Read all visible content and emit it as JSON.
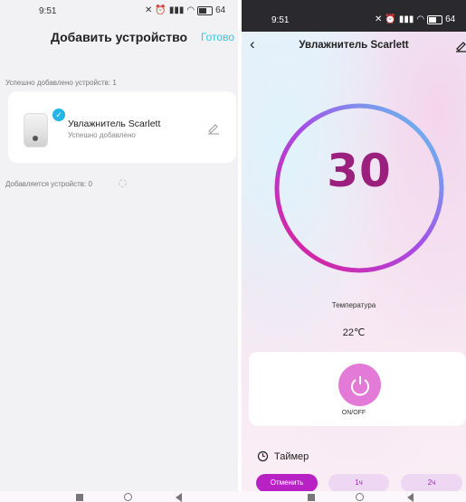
{
  "left": {
    "status": {
      "time": "9:51",
      "battery": "64"
    },
    "title": "Добавить устройство",
    "done_label": "Готово",
    "added_summary": "Успешно добавлено устройств: 1",
    "device": {
      "name": "Увлажнитель Scarlett",
      "status": "Успешно добавлено"
    },
    "adding_summary": "Добавляется устройств: 0"
  },
  "right": {
    "status": {
      "time": "9:51",
      "battery": "64"
    },
    "title": "Увлажнитель Scarlett",
    "target_value": "30",
    "temperature_label": "Температура",
    "temperature_value": "22℃",
    "power_label": "ON/OFF",
    "timer_label": "Таймер",
    "timer_options": [
      "Отменить",
      "1ч",
      "2ч"
    ]
  },
  "colors": {
    "accent_cyan": "#34c5e6",
    "ring_start": "#e11a8e",
    "ring_mid": "#a74be8",
    "ring_end": "#5ad0f0",
    "value_color": "#9b1f7c",
    "power_button": "#e37ad8",
    "chip_active": "#b822c4",
    "chip_inactive": "#eed7f3"
  },
  "icons": [
    "check-icon",
    "pencil-icon",
    "back-arrow-icon",
    "edit-icon",
    "power-icon",
    "timer-icon",
    "spinner-icon",
    "battery-icon",
    "wifi-icon",
    "signal-icon",
    "alarm-icon"
  ]
}
